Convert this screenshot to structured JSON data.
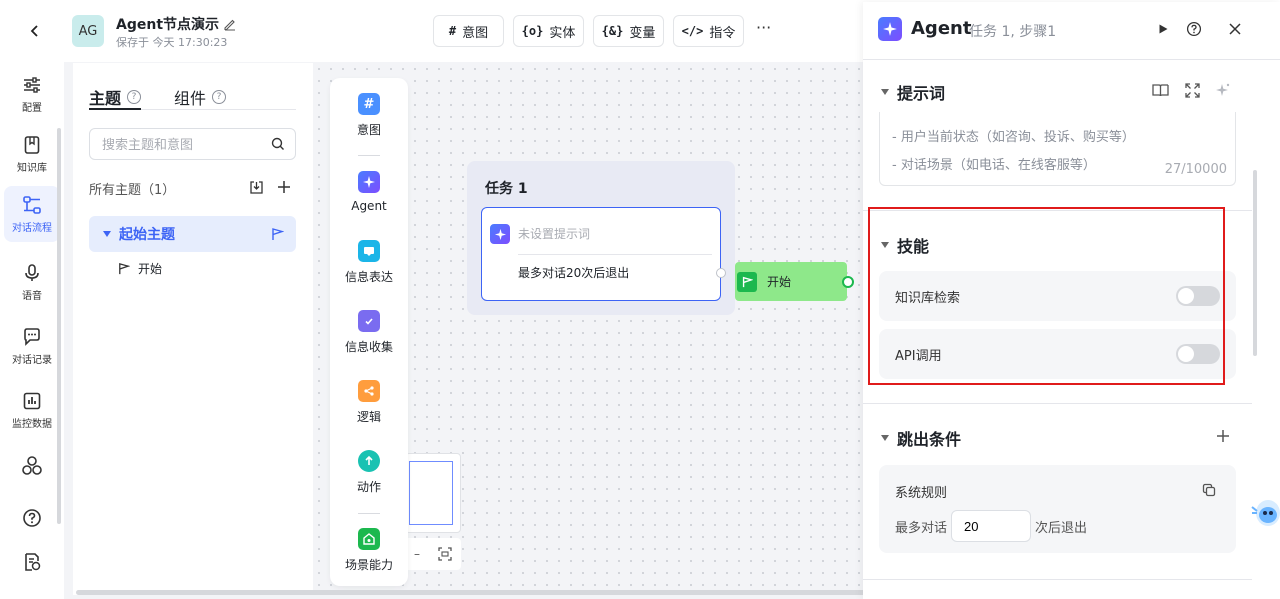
{
  "header": {
    "avatar_text": "AG",
    "title": "Agent节点演示",
    "saved": "保存于 今天 17:30:23",
    "toolbar": [
      {
        "icon": "hash-icon",
        "symbol": "#",
        "label": "意图"
      },
      {
        "icon": "entity-icon",
        "symbol": "{o}",
        "label": "实体"
      },
      {
        "icon": "variable-icon",
        "symbol": "{&}",
        "label": "变量"
      },
      {
        "icon": "code-icon",
        "symbol": "</>",
        "label": "指令"
      }
    ],
    "more": "···"
  },
  "rail": [
    {
      "label": "配置",
      "icon": "sliders-icon"
    },
    {
      "label": "知识库",
      "icon": "book-icon"
    },
    {
      "label": "对话流程",
      "icon": "flow-icon",
      "active": true
    },
    {
      "label": "语音",
      "icon": "microphone-icon"
    },
    {
      "label": "对话记录",
      "icon": "chat-icon"
    },
    {
      "label": "监控数据",
      "icon": "chart-icon"
    },
    {
      "label": "",
      "icon": "apps-icon"
    },
    {
      "label": "",
      "icon": "help-icon"
    },
    {
      "label": "",
      "icon": "doc-settings-icon"
    }
  ],
  "topics": {
    "tab_topic": "主题",
    "tab_component": "组件",
    "search_placeholder": "搜索主题和意图",
    "all_label": "所有主题（1）",
    "topic_name": "起始主题",
    "child_name": "开始"
  },
  "palette": [
    {
      "label": "意图",
      "icon": "intent-icon",
      "color": "#4a90ff"
    },
    {
      "label": "Agent",
      "icon": "agent-icon",
      "color": "#5b6cff"
    },
    {
      "label": "信息表达",
      "icon": "message-icon",
      "color": "#1bb5e8"
    },
    {
      "label": "信息收集",
      "icon": "collect-icon",
      "color": "#7a6cf0"
    },
    {
      "label": "逻辑",
      "icon": "logic-icon",
      "color": "#ff9d3d"
    },
    {
      "label": "动作",
      "icon": "action-icon",
      "color": "#19c2b2"
    },
    {
      "label": "场景能力",
      "icon": "scene-icon",
      "color": "#1cb84e"
    }
  ],
  "canvas": {
    "task_title": "任务 1",
    "prompt_placeholder": "未设置提示词",
    "exit_rule": "最多对话20次后退出",
    "start_label": "开始",
    "minimap_minus": "–"
  },
  "panel": {
    "title": "Agent",
    "subtitle": "任务 1, 步骤1",
    "prompt_section": "提示词",
    "prompt_lines": [
      "- 用户当前状态（如咨询、投诉、购买等）",
      "- 对话场景（如电话、在线客服等）"
    ],
    "prompt_count": "27/10000",
    "skills_section": "技能",
    "skills": [
      {
        "label": "知识库检索",
        "enabled": false
      },
      {
        "label": "API调用",
        "enabled": false
      }
    ],
    "exit_section": "跳出条件",
    "rule_title": "系统规则",
    "rule_prefix": "最多对话",
    "rule_value": "20",
    "rule_suffix": "次后退出"
  },
  "colors": {
    "accent": "#3d64f5",
    "highlight": "#e01b1b",
    "start_node": "#8ee88a"
  }
}
